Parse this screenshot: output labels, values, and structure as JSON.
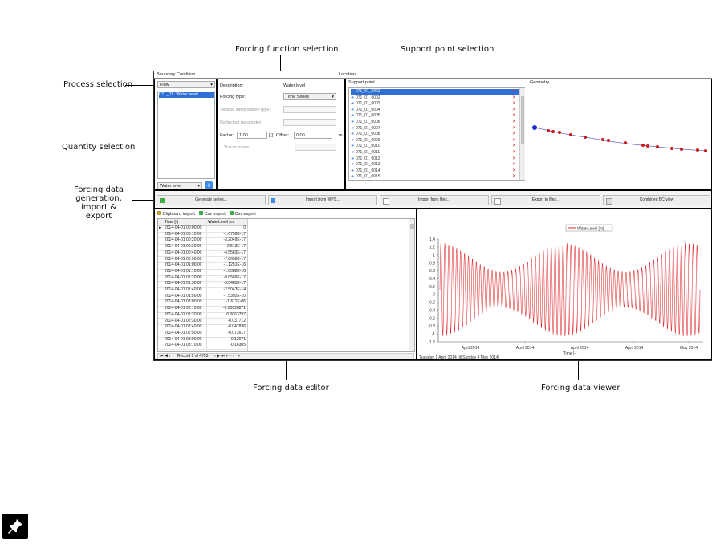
{
  "callouts": {
    "forcing_function": "Forcing function selection",
    "support_point": "Support point selection",
    "process": "Process selection",
    "quantity": "Quantity selection",
    "forcing_data_gen_1": "Forcing data",
    "forcing_data_gen_2": "generation,",
    "forcing_data_gen_3": "import & export",
    "editor": "Forcing data editor",
    "viewer": "Forcing data viewer"
  },
  "window": {
    "boundary_condition": "Boundary Condition",
    "location": "Location"
  },
  "left_panel": {
    "process_value": "Flow",
    "quantity_item": "071_01: Water level",
    "quantity_select": "Water level"
  },
  "props": {
    "description_label": "Description:",
    "description_value": "Water level",
    "forcing_type_label": "Forcing type:",
    "forcing_type_value": "Time Series",
    "vertical_interp_label": "Vertical interpolation type:",
    "reflection_label": "Reflection parameter:",
    "factor_label": "Factor:",
    "factor_value": "1.00",
    "unit_dash": "[-]",
    "offset_label": "Offset:",
    "offset_value": "0.00",
    "offset_unit": "m",
    "tracer_label": "Tracer name"
  },
  "support_points": {
    "header": "Support point",
    "items": [
      "071_01_0001",
      "071_01_0002",
      "071_01_0003",
      "071_01_0004",
      "071_01_0005",
      "071_01_0006",
      "071_01_0007",
      "071_01_0008",
      "071_01_0009",
      "071_01_0010",
      "071_01_0011",
      "071_01_0012",
      "071_01_0013",
      "071_01_0014",
      "071_01_0015"
    ],
    "geometry_label": "Geometry"
  },
  "toolbar": {
    "generate": "Generate series...",
    "import_wps": "Import from WPS...",
    "import_files": "Import from files...",
    "export_files": "Export to files...",
    "combined": "Combined BC view"
  },
  "editor": {
    "clipboard_import": "Clipboard import",
    "csv_import": "Csv import",
    "csv_export": "Csv export",
    "col_time": "Time [-]",
    "col_level": "WaterLevel [m]",
    "rows": [
      [
        "2014-04-01 00:00:00",
        "0"
      ],
      [
        "2014-04-01 00:10:00",
        "-1.6798E-17"
      ],
      [
        "2014-04-01 00:20:00",
        "-3.2049E-17"
      ],
      [
        "2014-04-01 00:30:00",
        "-2.513E-17"
      ],
      [
        "2014-04-01 00:40:00",
        "-4.5583E-17"
      ],
      [
        "2014-04-01 00:50:00",
        "-7.6658E-17"
      ],
      [
        "2014-04-01 01:00:00",
        "-1.1251E-16"
      ],
      [
        "2014-04-01 01:10:00",
        "-1.0088E-16"
      ],
      [
        "2014-04-01 01:20:00",
        "-9.0569E-17"
      ],
      [
        "2014-04-01 01:30:00",
        "-3.0483E-17"
      ],
      [
        "2014-04-01 01:40:00",
        "-2.5043E-14"
      ],
      [
        "2014-04-01 01:50:00",
        "-7.5392E-10"
      ],
      [
        "2014-04-01 02:00:00",
        "-1.611E-06"
      ],
      [
        "2014-04-01 02:10:00",
        "-0.00028871"
      ],
      [
        "2014-04-01 02:20:00",
        "-0.0063797"
      ],
      [
        "2014-04-01 02:30:00",
        "-0.037712"
      ],
      [
        "2014-04-01 02:40:00",
        "-0.047836"
      ],
      [
        "2014-04-01 02:50:00",
        "-0.073517"
      ],
      [
        "2014-04-01 03:00:00",
        "-0.12071"
      ],
      [
        "2014-04-01 03:10:00",
        "-0.16305"
      ]
    ],
    "record_text": "Record 1 of 4753"
  },
  "chart_data": {
    "type": "line",
    "series": [
      {
        "name": "WaterLevel [m]"
      }
    ],
    "y_ticks": [
      "1.4",
      "1.2",
      "1",
      "0.8",
      "0.6",
      "0.4",
      "0.2",
      "0",
      "-0.2",
      "-0.4",
      "-0.6",
      "-0.8",
      "-1",
      "-1.2"
    ],
    "ylim": [
      -1.2,
      1.4
    ],
    "x_ticks": [
      "April 2014",
      "April 2014",
      "April 2014",
      "April 2014",
      "May 2014"
    ],
    "xlabel": "Time [-]",
    "footer": "Tuesday 1 April 2014 till Sunday 4 May 2014)",
    "line_color": "#e0282b"
  }
}
